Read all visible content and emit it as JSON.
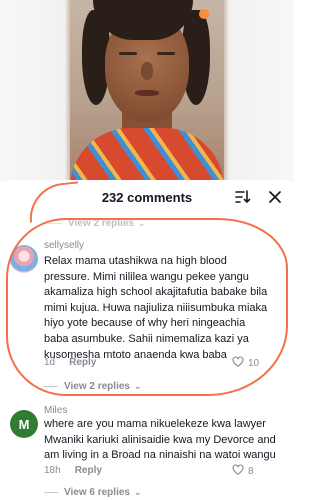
{
  "sheet": {
    "comment_count": "232 comments"
  },
  "comments": [
    {
      "username": "sellyselly",
      "text": "Relax mama utashikwa na high blood pressure. Mimi nililea wangu pekee yangu akamaliza high school akajitafutia babake bila mimi kujua. Huwa najiuliza niiisumbuka miaka hiyo yote because of why heri ningeachia baba asumbuke. Sahii nimemaliza kazi ya kusomesha mtoto anaenda kwa baba",
      "time": "1d",
      "reply_label": "Reply",
      "likes": "10",
      "view_replies": "View 2 replies"
    },
    {
      "username": "Miles",
      "avatar_letter": "M",
      "text": "where are you mama nikuelekeze kwa lawyer Mwaniki kariuki alinisaidie kwa my Devorce and am living in a Broad na ninaishi na watoi wangu",
      "time": "18h",
      "reply_label": "Reply",
      "likes": "8",
      "view_replies": "View 6 replies"
    }
  ],
  "top_view_replies": "View 2 replies",
  "colors": {
    "annotation": "#f27148",
    "muted_text": "#8a8b91",
    "avatar_letter_bg": "#2f7d32"
  },
  "icons": [
    "sort-icon",
    "close-icon",
    "heart-icon",
    "chevron-down-icon"
  ]
}
